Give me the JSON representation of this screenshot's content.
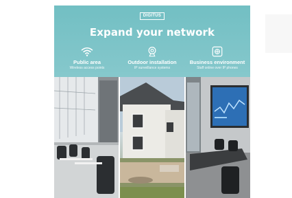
{
  "banner": {
    "logo": "DIGITUS",
    "headline": "Expand your network",
    "features": [
      {
        "icon": "wifi-icon",
        "title": "Public area",
        "subtitle": "Wireless access points"
      },
      {
        "icon": "camera-icon",
        "title": "Outdoor installation",
        "subtitle": "IP surveillance systems"
      },
      {
        "icon": "network-icon",
        "title": "Business environment",
        "subtitle": "Staff online over IP phones"
      }
    ]
  },
  "colors": {
    "banner": "#78c2c6",
    "text": "#ffffff"
  }
}
